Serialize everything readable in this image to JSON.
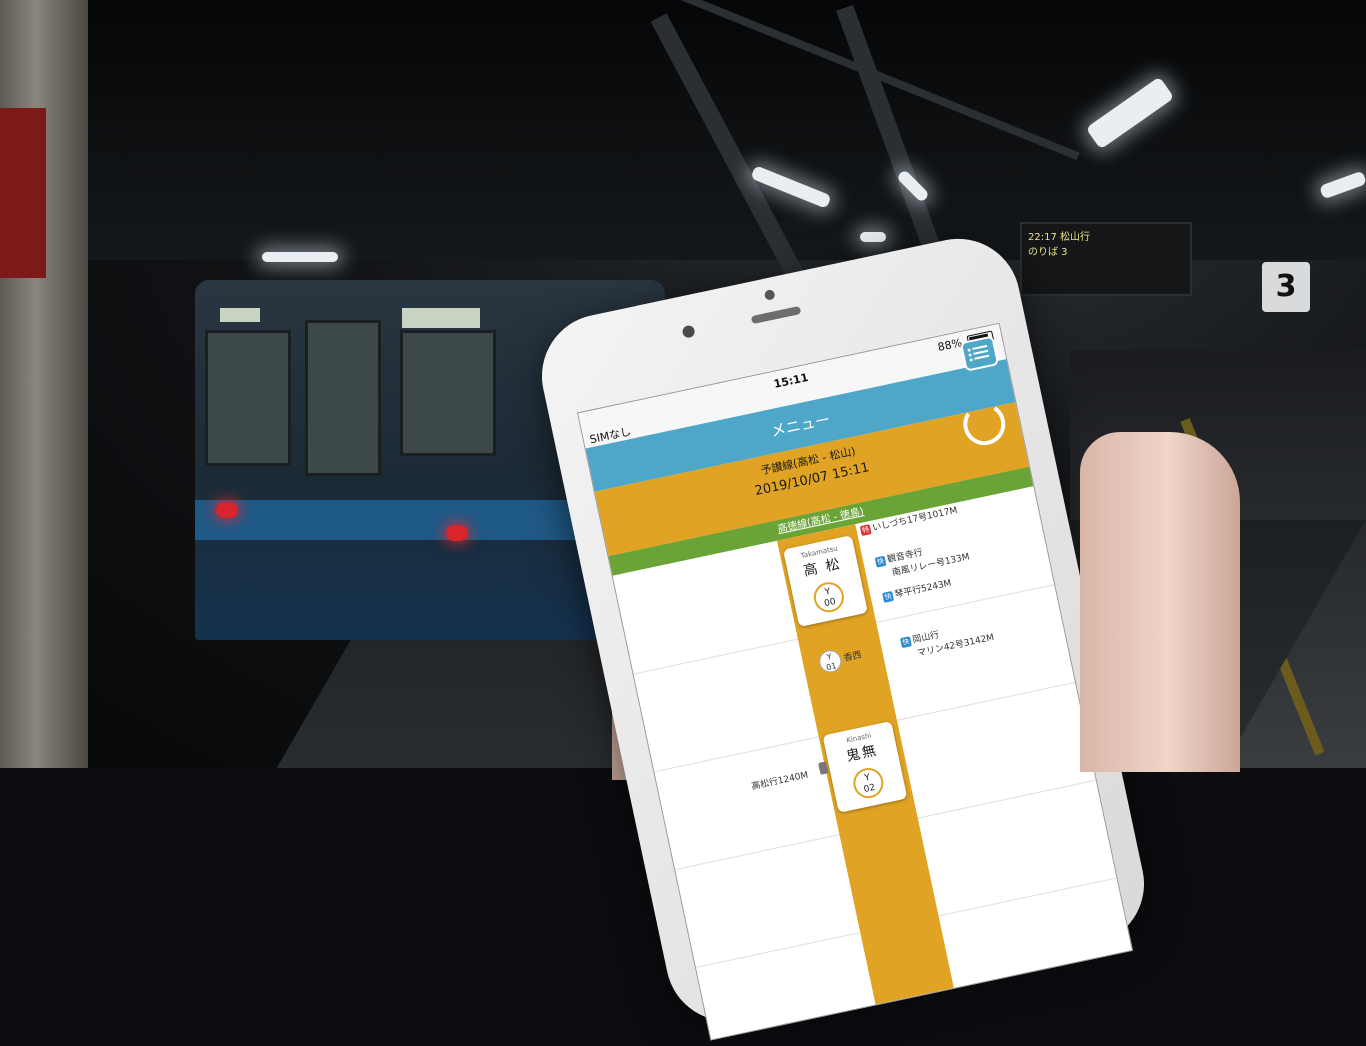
{
  "status_bar": {
    "carrier": "SIMなし",
    "time": "15:11",
    "battery": "88%"
  },
  "header": {
    "title": "メニュー"
  },
  "route_panel": {
    "route_name": "予讃線(高松 - 松山)",
    "datetime": "2019/10/07 15:11"
  },
  "line_bar": {
    "label": "高徳線(高松 - 徳島)"
  },
  "stations": [
    {
      "roman": "Takamatsu",
      "name": "高 松",
      "badge_letter": "Y",
      "badge_num": "00"
    },
    {
      "roman": "Kinashi",
      "name": "鬼無",
      "badge_letter": "Y",
      "badge_num": "02"
    }
  ],
  "intermediate_stop": {
    "badge_letter": "Y",
    "badge_num": "01",
    "name": "香西"
  },
  "trains": [
    {
      "tag": "特",
      "text": "いしづち17号1017M"
    },
    {
      "tag": "快",
      "text": "観音寺行"
    },
    {
      "tag": "",
      "text": "南風リレー号133M"
    },
    {
      "tag": "快",
      "text": "琴平行5243M"
    },
    {
      "tag": "快",
      "text": "岡山行"
    },
    {
      "tag": "",
      "text": "マリン42号3142M"
    },
    {
      "tag": "",
      "text": "高松行1240M"
    }
  ],
  "board": {
    "line1": "22:17 松山行",
    "line2": "のりば 3"
  },
  "platform_number": "3",
  "colors": {
    "header": "#4ea7c9",
    "route": "#e0a323",
    "line_bar": "#6aa437"
  }
}
